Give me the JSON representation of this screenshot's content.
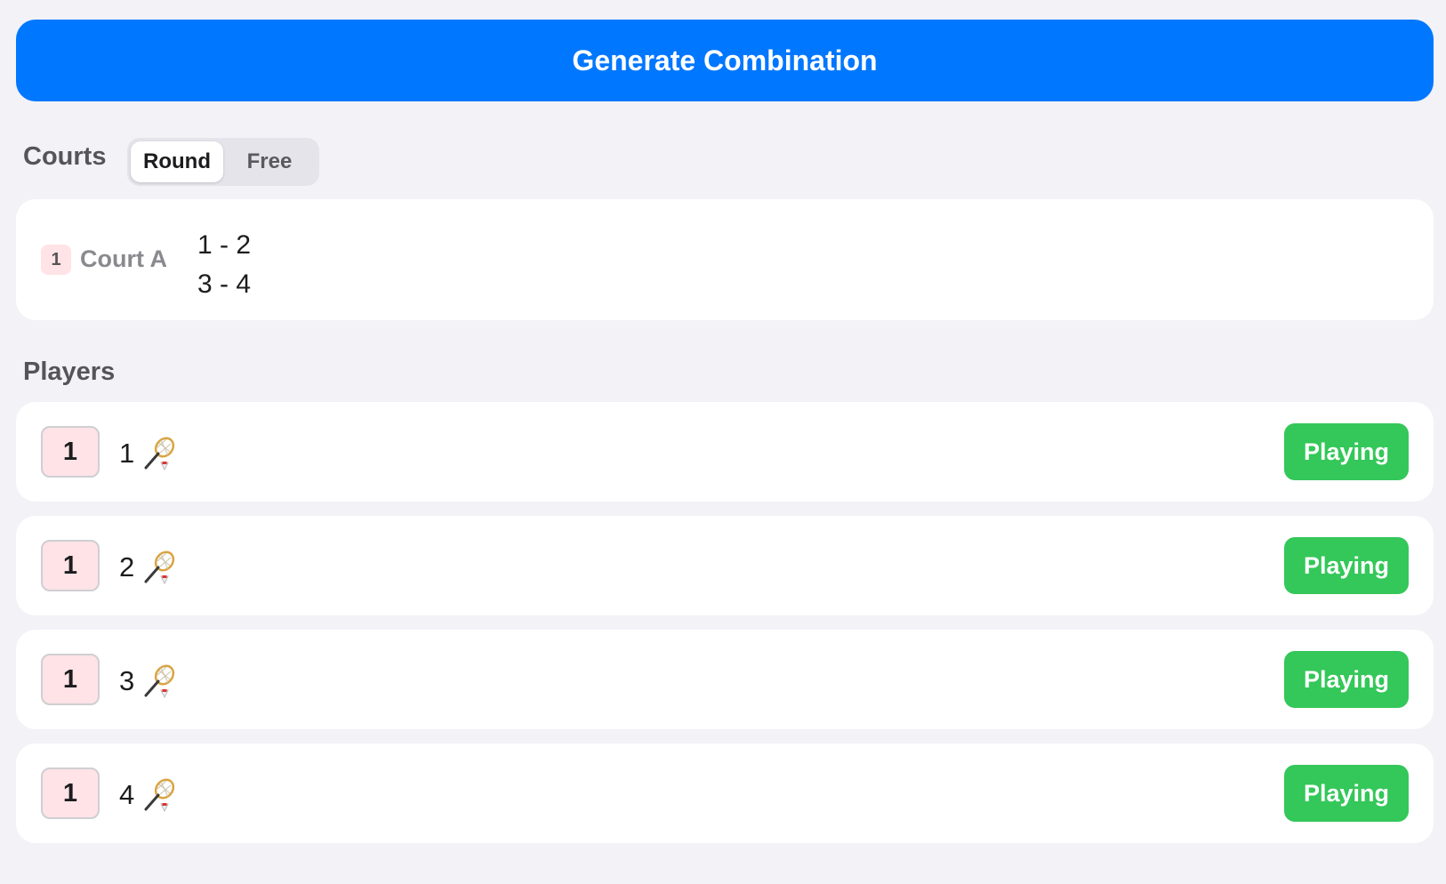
{
  "generate_button": {
    "label": "Generate Combination"
  },
  "courts": {
    "title": "Courts",
    "mode_tabs": [
      {
        "label": "Round",
        "active": true
      },
      {
        "label": "Free",
        "active": false
      }
    ],
    "items": [
      {
        "badge": "1",
        "name": "Court A",
        "matches": [
          "1 - 2",
          "3 - 4"
        ]
      }
    ]
  },
  "players": {
    "title": "Players",
    "items": [
      {
        "count": "1",
        "name": "1",
        "icon": "badminton-racket-icon",
        "status": "Playing"
      },
      {
        "count": "1",
        "name": "2",
        "icon": "badminton-racket-icon",
        "status": "Playing"
      },
      {
        "count": "1",
        "name": "3",
        "icon": "badminton-racket-icon",
        "status": "Playing"
      },
      {
        "count": "1",
        "name": "4",
        "icon": "badminton-racket-icon",
        "status": "Playing"
      }
    ]
  },
  "colors": {
    "primary": "#0077ff",
    "success": "#34c759",
    "badge_bg": "#ffe3e6",
    "page_bg": "#f2f2f7"
  }
}
